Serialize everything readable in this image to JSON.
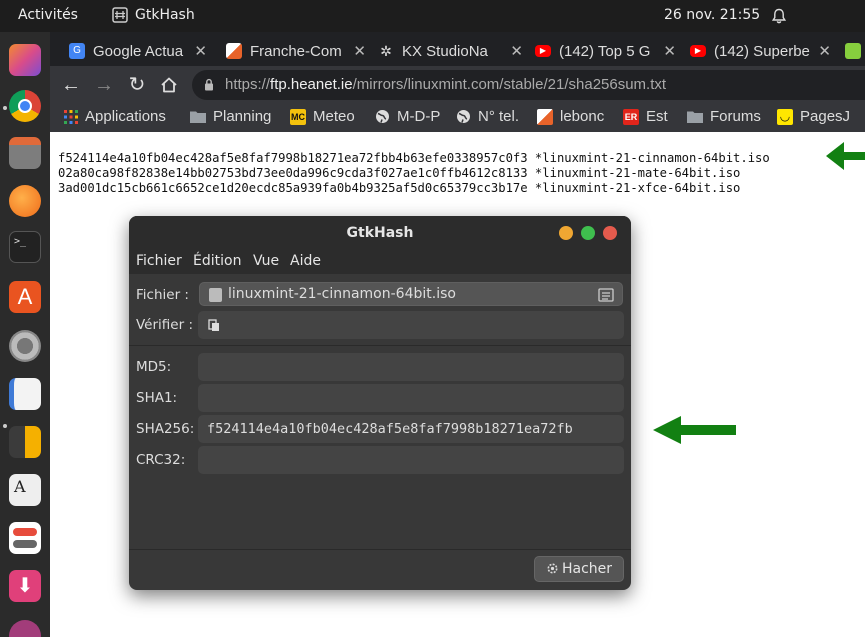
{
  "topbar": {
    "activities": "Activités",
    "app_name": "GtkHash",
    "clock": "26 nov.  21:55"
  },
  "tabs": [
    {
      "label": "Google Actua",
      "favicon_color": "#4285f4",
      "favicon_text": "G"
    },
    {
      "label": "Franche-Com",
      "favicon_color": "#e8632a",
      "favicon_text": ""
    },
    {
      "label": "KX StudioNa",
      "favicon_color": "#202124",
      "favicon_text": "✲"
    },
    {
      "label": "(142) Top 5 G",
      "favicon_color": "#ff0000",
      "favicon_text": "▶"
    },
    {
      "label": "(142) Superbe",
      "favicon_color": "#ff0000",
      "favicon_text": "▶"
    }
  ],
  "url": {
    "scheme": "https://",
    "host": "ftp.heanet.ie",
    "path": "/mirrors/linuxmint.com/stable/21/sha256sum.txt"
  },
  "bookmarks": [
    {
      "label": "Applications",
      "icon": "apps-grid-icon",
      "color": "#e94235"
    },
    {
      "label": "Planning",
      "icon": "folder-icon",
      "color": "#9aa0a6"
    },
    {
      "label": "Meteo",
      "icon": "mc-icon",
      "color": "#f4c20d",
      "text": "MC"
    },
    {
      "label": "M-D-P",
      "icon": "globe-icon",
      "color": "#dddddd"
    },
    {
      "label": "N° tel.",
      "icon": "globe-icon",
      "color": "#dddddd"
    },
    {
      "label": "lebonc",
      "icon": "leboncoin-icon",
      "color": "#e8632a"
    },
    {
      "label": "Est",
      "icon": "er-icon",
      "color": "#e1251b",
      "text": "ER"
    },
    {
      "label": "Forums",
      "icon": "folder-icon",
      "color": "#9aa0a6"
    },
    {
      "label": "PagesJ",
      "icon": "pagesjaunes-icon",
      "color": "#ffe600"
    }
  ],
  "sha256_lines": [
    "f524114e4a10fb04ec428af5e8faf7998b18271ea72fbb4b63efe0338957c0f3 *linuxmint-21-cinnamon-64bit.iso",
    "02a80ca98f82838e14bb02753bd73ee0da996c9cda3f027ae1c0ffb4612c8133 *linuxmint-21-mate-64bit.iso",
    "3ad001dc15cb661c6652ce1d20ecdc85a939fa0b4b9325af5d0c65379cc3b17e *linuxmint-21-xfce-64bit.iso"
  ],
  "gtkhash": {
    "title": "GtkHash",
    "menu": [
      "Fichier",
      "Édition",
      "Vue",
      "Aide"
    ],
    "file_label": "Fichier :",
    "file_name": "linuxmint-21-cinnamon-64bit.iso",
    "verify_label": "Vérifier :",
    "verify_value": "",
    "hashes": [
      {
        "name": "MD5:",
        "value": ""
      },
      {
        "name": "SHA1:",
        "value": ""
      },
      {
        "name": "SHA256:",
        "value": "f524114e4a10fb04ec428af5e8faf7998b18271ea72fb"
      },
      {
        "name": "CRC32:",
        "value": ""
      }
    ],
    "hash_button": "Hacher"
  },
  "colors": {
    "arrow": "#128012",
    "close_btn": "#e55b4d",
    "maximize_btn": "#3fbf4e",
    "minimize_btn": "#f0a732"
  }
}
